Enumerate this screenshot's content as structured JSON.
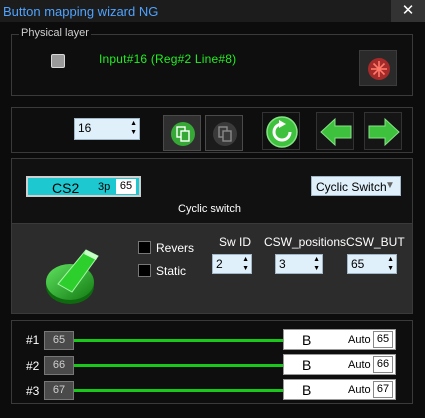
{
  "window": {
    "title": "Button mapping wizard NG",
    "close_glyph": "✕"
  },
  "physical": {
    "legend": "Physical layer",
    "input_info": "Input#16  (Reg#2  Line#8)"
  },
  "toolbar": {
    "index_value": "16"
  },
  "switch": {
    "name": "CS2",
    "pins": "3p",
    "number": "65",
    "type_value": "Cyclic Switch",
    "type_caption": "Cyclic switch"
  },
  "params": {
    "revers_label": "Revers",
    "static_label": "Static",
    "swid_header": "Sw ID",
    "positions_header": "CSW_positions",
    "button_header": "CSW_BUT",
    "swid_value": "2",
    "positions_value": "3",
    "button_value": "65"
  },
  "rows": [
    {
      "label": "#1",
      "input": "65",
      "key": "B",
      "mode": "Auto",
      "num": "65"
    },
    {
      "label": "#2",
      "input": "66",
      "key": "B",
      "mode": "Auto",
      "num": "66"
    },
    {
      "label": "#3",
      "input": "67",
      "key": "B",
      "mode": "Auto",
      "num": "67"
    }
  ],
  "colors": {
    "accent_green": "#19c919",
    "cyan": "#1ec8d0",
    "title_blue": "#4fa3ff"
  },
  "icons": [
    "close-icon",
    "stop-icon",
    "copy-icon",
    "paste-icon",
    "refresh-icon",
    "arrow-left-icon",
    "arrow-right-icon",
    "knob-icon"
  ]
}
